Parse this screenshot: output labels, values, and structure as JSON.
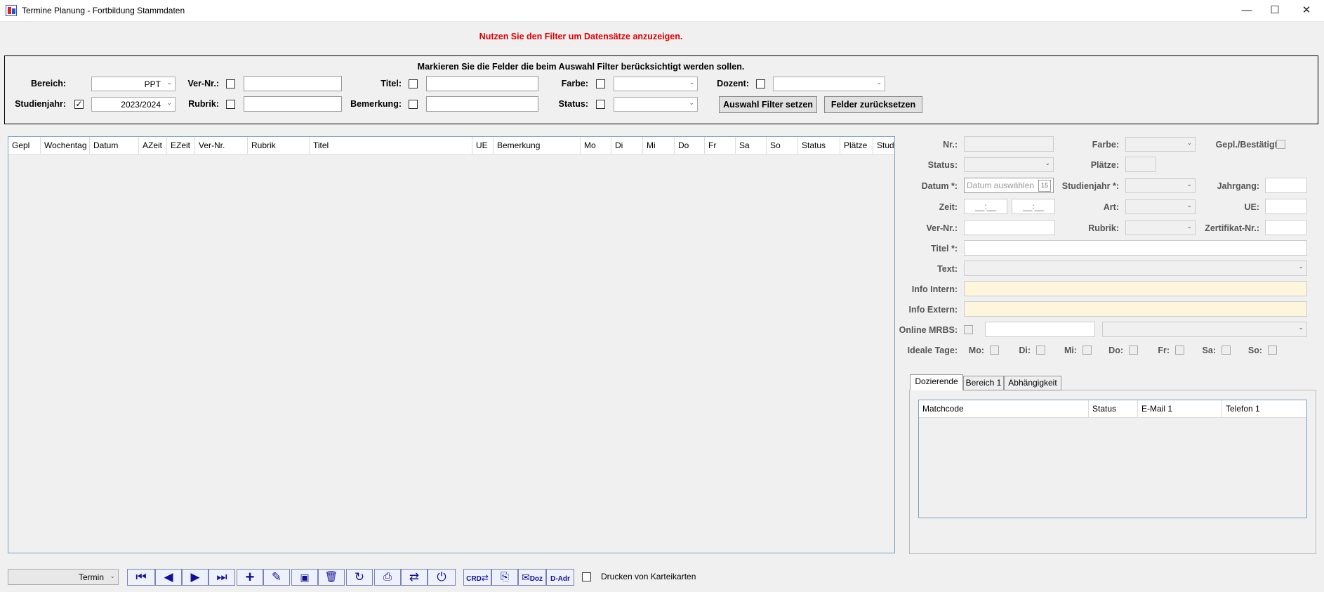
{
  "window": {
    "title": "Termine Planung - Fortbildung Stammdaten",
    "minimize": "—",
    "maximize": "☐",
    "close": "✕"
  },
  "notice": "Nutzen Sie den Filter um Datensätze anzuzeigen.",
  "filter": {
    "hint": "Markieren Sie die Felder die beim Auswahl Filter berücksichtigt werden sollen.",
    "bereich_label": "Bereich:",
    "bereich_value": "PPT",
    "studienjahr_label": "Studienjahr:",
    "studienjahr_checked": "✓",
    "studienjahr_value": "2023/2024",
    "vernr_label": "Ver-Nr.:",
    "rubrik_label": "Rubrik:",
    "titel_label": "Titel:",
    "bemerkung_label": "Bemerkung:",
    "farbe_label": "Farbe:",
    "status_label": "Status:",
    "dozent_label": "Dozent:",
    "apply_button": "Auswahl Filter setzen",
    "reset_button": "Felder zurücksetzen"
  },
  "grid": {
    "columns": [
      "Gepl",
      "Wochentag",
      "Datum",
      "AZeit",
      "EZeit",
      "Ver-Nr.",
      "Rubrik",
      "Titel",
      "UE",
      "Bemerkung",
      "Mo",
      "Di",
      "Mi",
      "Do",
      "Fr",
      "Sa",
      "So",
      "Status",
      "Plätze",
      "Stud"
    ]
  },
  "form": {
    "nr_label": "Nr.:",
    "farbe_label": "Farbe:",
    "gepl_label": "Gepl./Bestätigt:",
    "status_label": "Status:",
    "plaetze_label": "Plätze:",
    "datum_label": "Datum *:",
    "datum_placeholder": "Datum auswählen",
    "calendar_day": "15",
    "studienjahr_label": "Studienjahr *:",
    "jahrgang_label": "Jahrgang:",
    "zeit_label": "Zeit:",
    "zeit_from": "__:__",
    "zeit_to": "__:__",
    "art_label": "Art:",
    "ue_label": "UE:",
    "vernr_label": "Ver-Nr.:",
    "rubrik_label": "Rubrik:",
    "zertifikat_label": "Zertifikat-Nr.:",
    "titel_label": "Titel *:",
    "text_label": "Text:",
    "info_intern_label": "Info Intern:",
    "info_extern_label": "Info Extern:",
    "online_mrbs_label": "Online MRBS:",
    "ideale_tage_label": "Ideale Tage:",
    "days": [
      "Mo:",
      "Di:",
      "Mi:",
      "Do:",
      "Fr:",
      "Sa:",
      "So:"
    ]
  },
  "tabs": [
    "Dozierende",
    "Bereich 1",
    "Abhängigkeit"
  ],
  "dozenten_grid": {
    "columns": [
      "Matchcode",
      "Status",
      "E-Mail 1",
      "Telefon 1"
    ]
  },
  "toolbar": {
    "mode_value": "Termin",
    "print_cards_label": "Drucken von Karteikarten",
    "dozent_label": "Doz",
    "dadr_label": "D-Adr",
    "crd_label": "CRD"
  }
}
